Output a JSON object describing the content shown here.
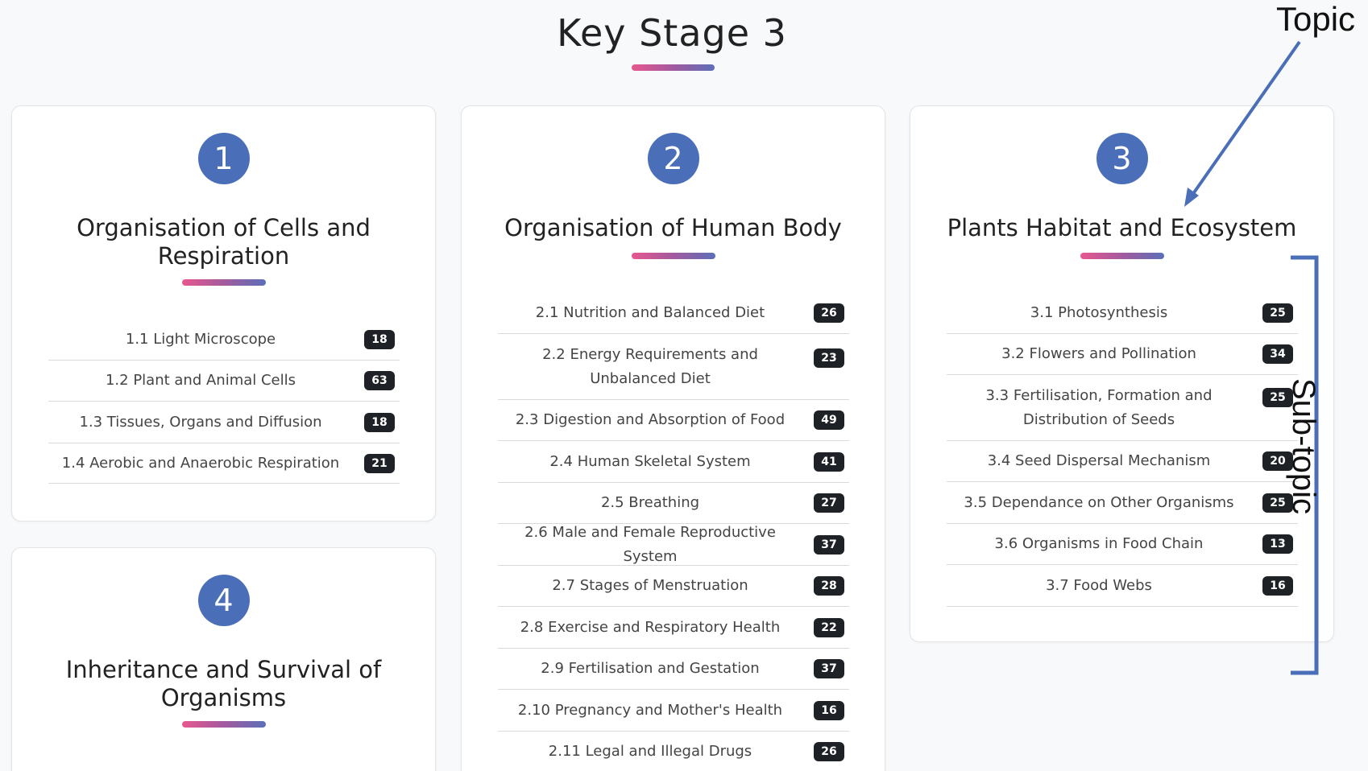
{
  "page": {
    "title": "Key Stage 3"
  },
  "annotations": {
    "topic_label": "Topic",
    "subtopic_label": "Sub-topic",
    "arrow_color": "#4a6fb8",
    "bracket_color": "#4a6fb8"
  },
  "colors": {
    "circle": "#4a6fb8",
    "badge": "#1e2226",
    "gradient": [
      "#e8578f",
      "#a25a9e",
      "#5b6fb8"
    ]
  },
  "topics": [
    {
      "number": "1",
      "title": "Organisation of Cells and Respiration",
      "subtopics": [
        {
          "label": "1.1 Light Microscope",
          "count": "18"
        },
        {
          "label": "1.2 Plant and Animal Cells",
          "count": "63"
        },
        {
          "label": "1.3 Tissues, Organs and Diffusion",
          "count": "18"
        },
        {
          "label": "1.4 Aerobic and Anaerobic Respiration",
          "count": "21"
        }
      ]
    },
    {
      "number": "2",
      "title": "Organisation of Human Body",
      "subtopics": [
        {
          "label": "2.1 Nutrition and Balanced Diet",
          "count": "26"
        },
        {
          "label": "2.2 Energy Requirements and Unbalanced Diet",
          "count": "23"
        },
        {
          "label": "2.3 Digestion and Absorption of Food",
          "count": "49"
        },
        {
          "label": "2.4 Human Skeletal System",
          "count": "41"
        },
        {
          "label": "2.5 Breathing",
          "count": "27"
        },
        {
          "label": "2.6 Male and Female Reproductive System",
          "count": "37"
        },
        {
          "label": "2.7 Stages of Menstruation",
          "count": "28"
        },
        {
          "label": "2.8 Exercise and Respiratory Health",
          "count": "22"
        },
        {
          "label": "2.9 Fertilisation and Gestation",
          "count": "37"
        },
        {
          "label": "2.10 Pregnancy and Mother's Health",
          "count": "16"
        },
        {
          "label": "2.11 Legal and Illegal Drugs",
          "count": "26"
        }
      ]
    },
    {
      "number": "3",
      "title": "Plants Habitat and Ecosystem",
      "subtopics": [
        {
          "label": "3.1 Photosynthesis",
          "count": "25"
        },
        {
          "label": "3.2 Flowers and Pollination",
          "count": "34"
        },
        {
          "label": "3.3 Fertilisation, Formation and Distribution of Seeds",
          "count": "25"
        },
        {
          "label": "3.4 Seed Dispersal Mechanism",
          "count": "20"
        },
        {
          "label": "3.5 Dependance on Other Organisms",
          "count": "25"
        },
        {
          "label": "3.6 Organisms in Food Chain",
          "count": "13"
        },
        {
          "label": "3.7 Food Webs",
          "count": "16"
        }
      ]
    },
    {
      "number": "4",
      "title": "Inheritance and Survival of Organisms",
      "subtopics": []
    }
  ]
}
